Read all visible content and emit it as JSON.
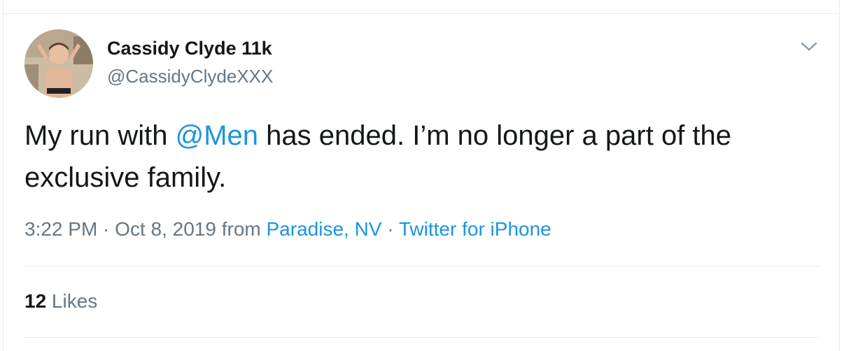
{
  "author": {
    "display_name": "Cassidy Clyde 11k",
    "handle": "@CassidyClydeXXX",
    "avatar_icon": "profile-photo"
  },
  "tweet": {
    "text_before": "My run with ",
    "mention": "@Men",
    "text_after": " has ended. I’m no longer a part of the exclusive family."
  },
  "meta": {
    "time": "3:22 PM",
    "separator": " · ",
    "date": "Oct 8, 2019",
    "from_label": " from ",
    "location": "Paradise, NV",
    "source": "Twitter for iPhone"
  },
  "stats": {
    "likes_count": "12",
    "likes_label": " Likes"
  },
  "menu_icon": "chevron-down-icon",
  "colors": {
    "link": "#1b95e0",
    "secondary_text": "#657786",
    "primary_text": "#14171a",
    "divider": "#e6ecf0"
  }
}
